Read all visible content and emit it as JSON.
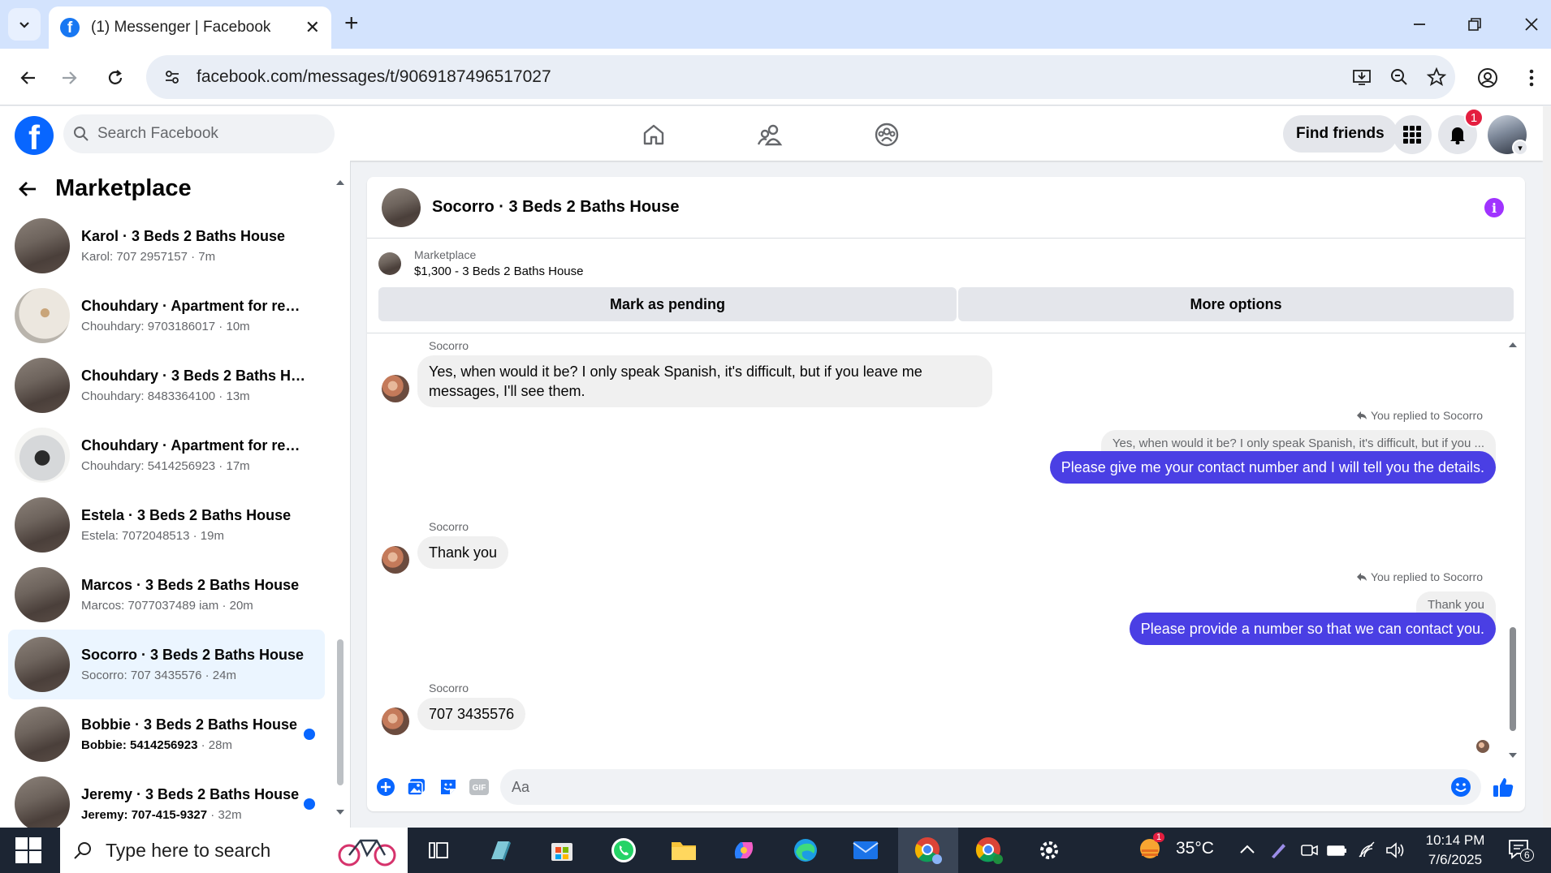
{
  "browser": {
    "tab_title": "(1) Messenger | Facebook",
    "url": "facebook.com/messages/t/9069187496517027"
  },
  "fb_header": {
    "search_placeholder": "Search Facebook",
    "find_friends_label": "Find friends",
    "notification_count": "1"
  },
  "left_pane": {
    "title": "Marketplace",
    "chats": [
      {
        "name": "Karol · 3 Beds 2 Baths House",
        "preview": "Karol: 707 2957157",
        "time": "7m",
        "thumb": "floor",
        "unread": false,
        "active": false
      },
      {
        "name": "Chouhdary · Apartment for rent...",
        "preview": "Chouhdary: 9703186017",
        "time": "10m",
        "thumb": "room",
        "unread": false,
        "active": false
      },
      {
        "name": "Chouhdary · 3 Beds 2 Baths Ho...",
        "preview": "Chouhdary: 8483364100",
        "time": "13m",
        "thumb": "floor",
        "unread": false,
        "active": false
      },
      {
        "name": "Chouhdary · Apartment for rent...",
        "preview": "Chouhdary: 5414256923",
        "time": "17m",
        "thumb": "light",
        "unread": false,
        "active": false
      },
      {
        "name": "Estela · 3 Beds 2 Baths House",
        "preview": "Estela: 7072048513",
        "time": "19m",
        "thumb": "floor",
        "unread": false,
        "active": false
      },
      {
        "name": "Marcos · 3 Beds 2 Baths House",
        "preview": "Marcos: 7077037489 iam",
        "time": "20m",
        "thumb": "floor",
        "unread": false,
        "active": false
      },
      {
        "name": "Socorro · 3 Beds 2 Baths House",
        "preview": "Socorro: 707 3435576",
        "time": "24m",
        "thumb": "floor",
        "unread": false,
        "active": true
      },
      {
        "name": "Bobbie · 3 Beds 2 Baths House",
        "preview": "Bobbie: 5414256923",
        "time": "28m",
        "thumb": "floor",
        "unread": true,
        "active": false
      },
      {
        "name": "Jeremy · 3 Beds 2 Baths House",
        "preview": "Jeremy: 707-415-9327",
        "time": "32m",
        "thumb": "floor",
        "unread": true,
        "active": false
      }
    ]
  },
  "conversation": {
    "title": "Socorro · 3 Beds 2 Baths House",
    "listing_category": "Marketplace",
    "listing_title": "$1,300 - 3 Beds 2 Baths House",
    "mark_pending_label": "Mark as pending",
    "more_options_label": "More options",
    "sender_name": "Socorro",
    "replied_label": "You replied to Socorro",
    "messages": {
      "in1": "Yes, when would it be? I only speak Spanish, it's difficult, but if you leave me messages, I'll see them.",
      "quote1": "Yes, when would it be? I only speak Spanish, it's difficult, but if you ...",
      "out1": "Please give me your contact number and I will tell you the details.",
      "in2": "Thank you",
      "quote2": "Thank you",
      "out2": "Please provide a number so that we can contact you.",
      "in3": "707 3435576"
    },
    "composer_placeholder": "Aa",
    "gif_label": "GIF"
  },
  "taskbar": {
    "search_placeholder": "Type here to search",
    "temperature": "35°C",
    "weather_badge": "1",
    "time": "10:14 PM",
    "date": "7/6/2025",
    "notification_count": "6"
  }
}
